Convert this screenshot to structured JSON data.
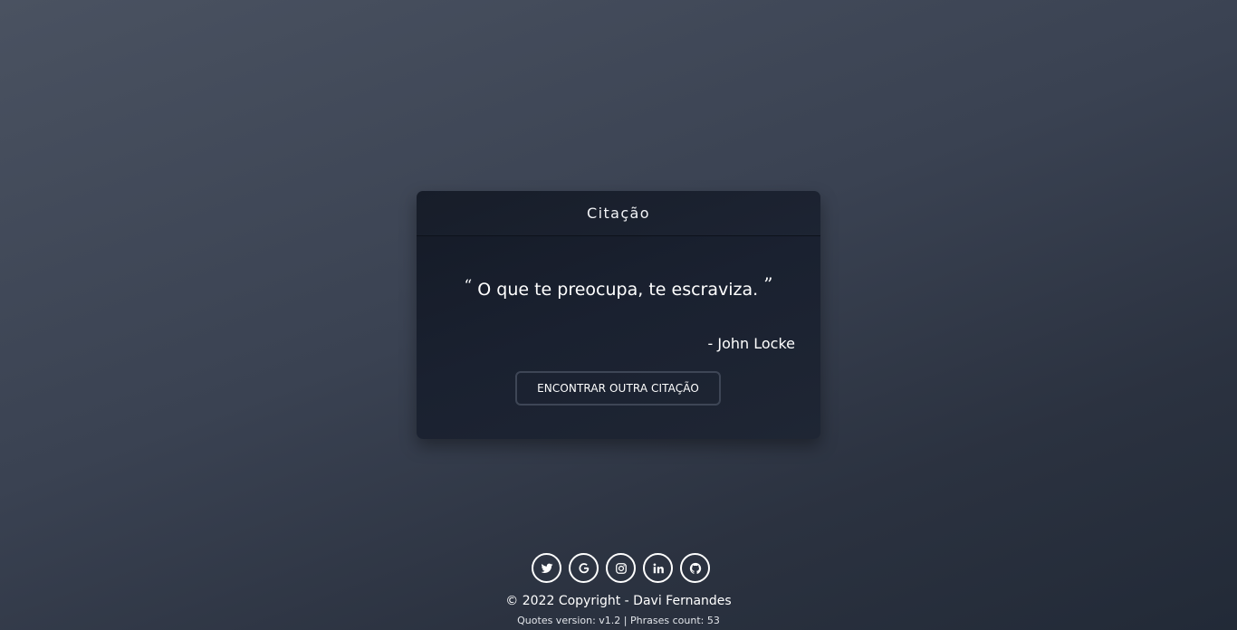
{
  "card": {
    "title": "Citação",
    "quote_open": "“",
    "quote_text": "O que te preocupa, te escraviza.",
    "quote_close": "”",
    "author": "- John Locke",
    "button_label": "ENCONTRAR OUTRA CITAÇÃO"
  },
  "footer": {
    "social_icons": [
      "twitter-icon",
      "google-icon",
      "instagram-icon",
      "linkedin-icon",
      "github-icon"
    ],
    "copyright": "© 2022 Copyright - Davi Fernandes",
    "version_info": "Quotes version: v1.2 | Phrases count: 53"
  },
  "colors": {
    "background_top": "#4a5261",
    "background_bottom": "#222a37",
    "card_background": "#1a2130",
    "button_border": "#3e4656",
    "text": "#ffffff"
  }
}
